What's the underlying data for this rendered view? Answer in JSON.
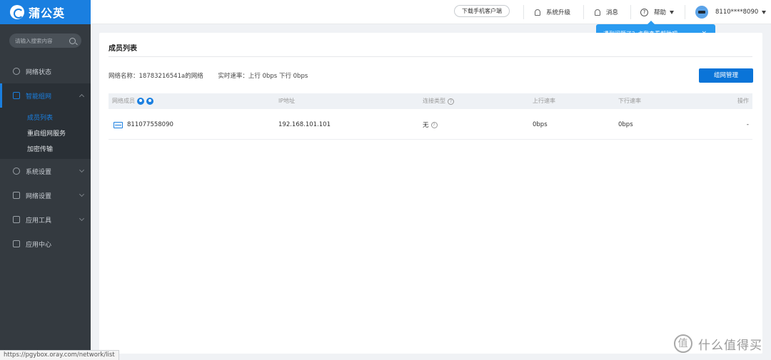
{
  "app": {
    "name": "蒲公英"
  },
  "sidebar": {
    "search_placeholder": "请输入搜索内容",
    "items": [
      {
        "label": "网络状态"
      },
      {
        "label": "智能组网"
      },
      {
        "label": "系统设置"
      },
      {
        "label": "网络设置"
      },
      {
        "label": "应用工具"
      },
      {
        "label": "应用中心"
      }
    ],
    "subitems": [
      {
        "label": "成员列表"
      },
      {
        "label": "重启组网服务"
      },
      {
        "label": "加密传输"
      }
    ]
  },
  "topbar": {
    "download_label": "下载手机客户端",
    "upgrade_label": "系统升级",
    "messages_label": "消息",
    "help_label": "帮助",
    "user_label": "8110****8090"
  },
  "tooltip": {
    "text": "遇到问题了？点我查看帮助吧~",
    "close": "×"
  },
  "panel": {
    "title": "成员列表",
    "network_name": "网络名称：18783216541a的网络",
    "speed": "实时速率：上行 0bps 下行 0bps",
    "manage_button": "组网管理"
  },
  "table": {
    "headers": {
      "member": "网络成员",
      "ip": "IP地址",
      "conn_type": "连接类型",
      "up": "上行速率",
      "down": "下行速率",
      "action": "操作"
    },
    "rows": [
      {
        "member": "811077558090",
        "ip": "192.168.101.101",
        "conn_type": "无",
        "up": "0bps",
        "down": "0bps",
        "action": "-"
      }
    ]
  },
  "status_url": "https://pgybox.oray.com/network/list",
  "watermark": {
    "glyph": "值",
    "text": "什么值得买"
  },
  "colors": {
    "accent": "#1a7fe0",
    "sidebar_bg": "#343a40",
    "button": "#0a74d8",
    "tooltip": "#2a9bf0"
  }
}
